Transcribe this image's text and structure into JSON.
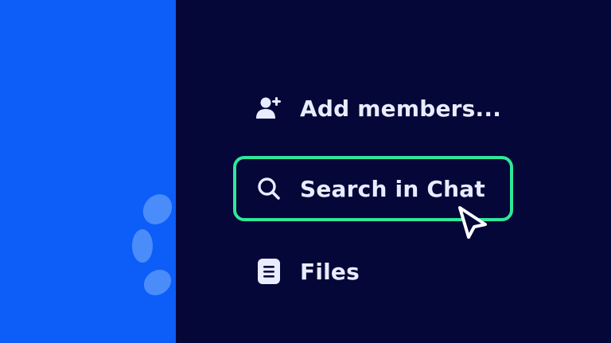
{
  "menu": {
    "items": [
      {
        "label": "Add members...",
        "icon": "add-user-icon"
      },
      {
        "label": "Search in Chat",
        "icon": "search-icon",
        "highlighted": true
      },
      {
        "label": "Files",
        "icon": "file-icon"
      }
    ]
  },
  "colors": {
    "left_panel": "#0d5ef8",
    "background": "#050738",
    "highlight_border": "#2ee89a",
    "text": "#e9ecff",
    "spinner": "#4b8cfb"
  },
  "icons": {
    "spinner": "loading-spinner-icon",
    "cursor": "mouse-pointer-icon"
  }
}
